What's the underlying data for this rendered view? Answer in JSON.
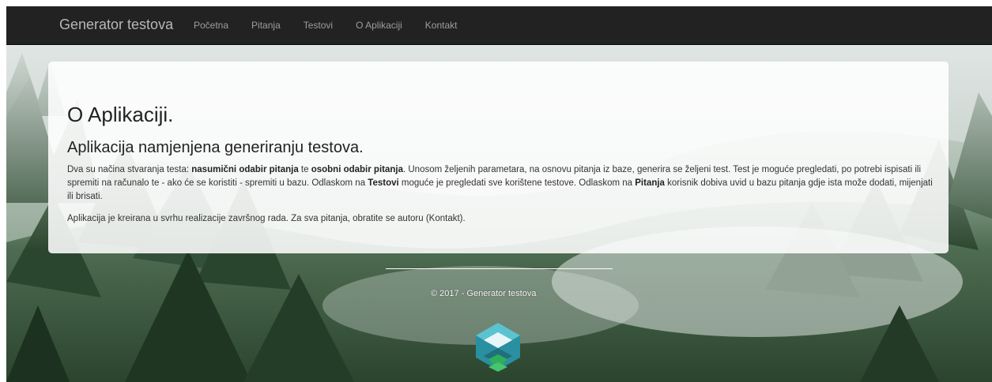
{
  "navbar": {
    "brand": "Generator testova",
    "links": [
      "Početna",
      "Pitanja",
      "Testovi",
      "O Aplikaciji",
      "Kontakt"
    ]
  },
  "main": {
    "title": "O Aplikaciji.",
    "subtitle": "Aplikacija namjenjena generiranju testova.",
    "description": {
      "p1": "Dva su načina stvaranja testa: ",
      "b1": "nasumični odabir pitanja",
      "p2": " te ",
      "b2": "osobni odabir pitanja",
      "p3": ". Unosom željenih parametara, na osnovu pitanja iz baze, generira se željeni test. Test je moguće pregledati, po potrebi ispisati ili spremiti na računalo te - ako će se koristiti - spremiti u bazu. Odlaskom na ",
      "b3": "Testovi",
      "p4": " moguće je pregledati sve korištene testove. Odlaskom na ",
      "b4": "Pitanja",
      "p5": " korisnik dobiva uvid u bazu pitanja gdje ista može dodati, mijenjati ili brisati."
    },
    "note": "Aplikacija je kreirana u svrhu realizacije završnog rada. Za sva pitanja, obratite se autoru (Kontakt)."
  },
  "footer": {
    "copyright": "© 2017 - Generator testova"
  },
  "colors": {
    "navbar_bg": "#222222",
    "brand_text": "#b8b8b8",
    "nav_link_text": "#9d9d9d",
    "panel_bg": "#ffffff",
    "logo_teal": "#2a8fa0",
    "logo_green": "#2fae5c"
  },
  "icons": {
    "logo": "footer-logo-icon"
  }
}
